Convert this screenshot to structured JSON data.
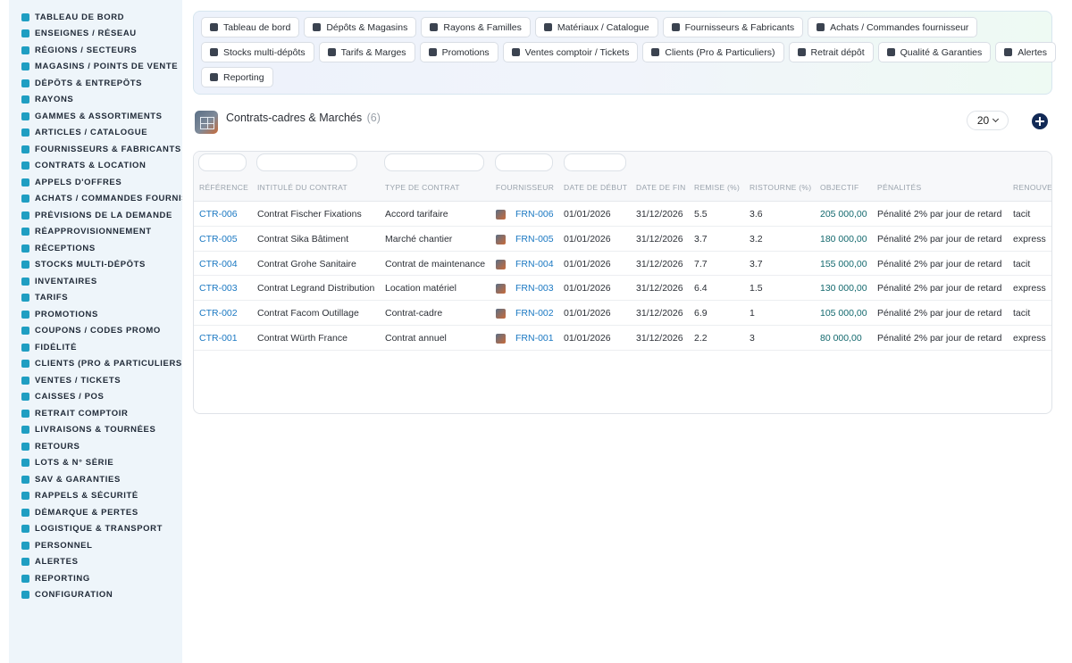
{
  "sidebar": {
    "items": [
      {
        "label": "TABLEAU DE BORD",
        "icon": "dashboard-icon"
      },
      {
        "label": "ENSEIGNES / RÉSEAU",
        "icon": "flag-icon"
      },
      {
        "label": "RÉGIONS / SECTEURS",
        "icon": "map-icon"
      },
      {
        "label": "MAGASINS / POINTS DE VENTE",
        "icon": "store-icon"
      },
      {
        "label": "DÉPÔTS & ENTREPÔTS",
        "icon": "warehouse-icon"
      },
      {
        "label": "RAYONS",
        "icon": "shelves-icon"
      },
      {
        "label": "GAMMES & ASSORTIMENTS",
        "icon": "grid-icon"
      },
      {
        "label": "ARTICLES / CATALOGUE",
        "icon": "catalog-icon"
      },
      {
        "label": "FOURNISSEURS & FABRICANTS",
        "icon": "factory-icon"
      },
      {
        "label": "CONTRATS & LOCATION",
        "icon": "contract-icon"
      },
      {
        "label": "APPELS D'OFFRES",
        "icon": "gavel-icon"
      },
      {
        "label": "ACHATS / COMMANDES FOURNISSEUR",
        "icon": "cart-icon"
      },
      {
        "label": "PRÉVISIONS DE LA DEMANDE",
        "icon": "chart-icon"
      },
      {
        "label": "RÉAPPROVISIONNEMENT",
        "icon": "refresh-icon"
      },
      {
        "label": "RÉCEPTIONS",
        "icon": "dolly-icon"
      },
      {
        "label": "STOCKS MULTI-DÉPÔTS",
        "icon": "stock-icon"
      },
      {
        "label": "INVENTAIRES",
        "icon": "clipboard-icon"
      },
      {
        "label": "TARIFS",
        "icon": "tag-icon"
      },
      {
        "label": "PROMOTIONS",
        "icon": "percent-icon"
      },
      {
        "label": "COUPONS / CODES PROMO",
        "icon": "ticket-icon"
      },
      {
        "label": "FIDÉLITÉ",
        "icon": "card-icon"
      },
      {
        "label": "CLIENTS (PRO & PARTICULIERS)",
        "icon": "user-icon"
      },
      {
        "label": "VENTES / TICKETS",
        "icon": "receipt-icon"
      },
      {
        "label": "CAISSES / POS",
        "icon": "cash-register-icon"
      },
      {
        "label": "RETRAIT COMPTOIR",
        "icon": "car-icon"
      },
      {
        "label": "LIVRAISONS & TOURNÉES",
        "icon": "truck-icon"
      },
      {
        "label": "RETOURS",
        "icon": "undo-icon"
      },
      {
        "label": "LOTS & N° SÉRIE",
        "icon": "barcode-icon"
      },
      {
        "label": "SAV & GARANTIES",
        "icon": "tools-icon"
      },
      {
        "label": "RAPPELS & SÉCURITÉ",
        "icon": "warning-icon"
      },
      {
        "label": "DÉMARQUE & PERTES",
        "icon": "trash-icon"
      },
      {
        "label": "LOGISTIQUE & TRANSPORT",
        "icon": "route-icon"
      },
      {
        "label": "PERSONNEL",
        "icon": "users-icon"
      },
      {
        "label": "ALERTES",
        "icon": "bell-icon"
      },
      {
        "label": "REPORTING",
        "icon": "pie-icon"
      },
      {
        "label": "CONFIGURATION",
        "icon": "gear-icon"
      }
    ]
  },
  "nav": {
    "row1": [
      {
        "label": "Tableau de bord",
        "icon": "dashboard-icon"
      },
      {
        "label": "Dépôts & Magasins",
        "icon": "warehouse-icon"
      },
      {
        "label": "Rayons & Familles",
        "icon": "basket-icon"
      },
      {
        "label": "Matériaux / Catalogue",
        "icon": "catalog-icon"
      },
      {
        "label": "Fournisseurs & Fabricants",
        "icon": "factory-icon"
      },
      {
        "label": "Achats / Commandes fournisseur",
        "icon": "cart-icon"
      }
    ],
    "row2": [
      {
        "label": "Stocks multi-dépôts",
        "icon": "stock-icon"
      },
      {
        "label": "Tarifs & Marges",
        "icon": "tag-icon"
      },
      {
        "label": "Promotions",
        "icon": "percent-icon"
      },
      {
        "label": "Ventes comptoir / Tickets",
        "icon": "receipt-icon"
      },
      {
        "label": "Clients (Pro & Particuliers)",
        "icon": "user-icon"
      },
      {
        "label": "Retrait dépôt",
        "icon": "car-icon"
      },
      {
        "label": "Qualité & Garanties",
        "icon": "check-double-icon"
      },
      {
        "label": "Alertes",
        "icon": "bell-icon"
      }
    ],
    "row3": [
      {
        "label": "Reporting",
        "icon": "pie-icon"
      }
    ]
  },
  "header": {
    "title": "Contrats-cadres & Marchés",
    "count": "(6)",
    "page_size": "20"
  },
  "table": {
    "columns": [
      "RÉFÉRENCE",
      "INTITULÉ DU CONTRAT",
      "TYPE DE CONTRAT",
      "FOURNISSEUR",
      "DATE DE DÉBUT",
      "DATE DE FIN",
      "REMISE (%)",
      "RISTOURNE (%)",
      "OBJECTIF",
      "PÉNALITÉS",
      "RENOUVE"
    ],
    "rows": [
      [
        "CTR-006",
        "Contrat Fischer Fixations",
        "Accord tarifaire",
        "FRN-006",
        "01/01/2026",
        "31/12/2026",
        "5.5",
        "3.6",
        "205 000,00",
        "Pénalité 2% par jour de retard",
        "tacit"
      ],
      [
        "CTR-005",
        "Contrat Sika Bâtiment",
        "Marché chantier",
        "FRN-005",
        "01/01/2026",
        "31/12/2026",
        "3.7",
        "3.2",
        "180 000,00",
        "Pénalité 2% par jour de retard",
        "express"
      ],
      [
        "CTR-004",
        "Contrat Grohe Sanitaire",
        "Contrat de maintenance",
        "FRN-004",
        "01/01/2026",
        "31/12/2026",
        "7.7",
        "3.7",
        "155 000,00",
        "Pénalité 2% par jour de retard",
        "tacit"
      ],
      [
        "CTR-003",
        "Contrat Legrand Distribution",
        "Location matériel",
        "FRN-003",
        "01/01/2026",
        "31/12/2026",
        "6.4",
        "1.5",
        "130 000,00",
        "Pénalité 2% par jour de retard",
        "express"
      ],
      [
        "CTR-002",
        "Contrat Facom Outillage",
        "Contrat-cadre",
        "FRN-002",
        "01/01/2026",
        "31/12/2026",
        "6.9",
        "1",
        "105 000,00",
        "Pénalité 2% par jour de retard",
        "tacit"
      ],
      [
        "CTR-001",
        "Contrat Würth France",
        "Contrat annuel",
        "FRN-001",
        "01/01/2026",
        "31/12/2026",
        "2.2",
        "3",
        "80 000,00",
        "Pénalité 2% par jour de retard",
        "express"
      ]
    ]
  },
  "colors": {
    "accent": "#1f9ec2",
    "link": "#1a78c2",
    "objective": "#13696e",
    "add_button": "#122a56"
  }
}
